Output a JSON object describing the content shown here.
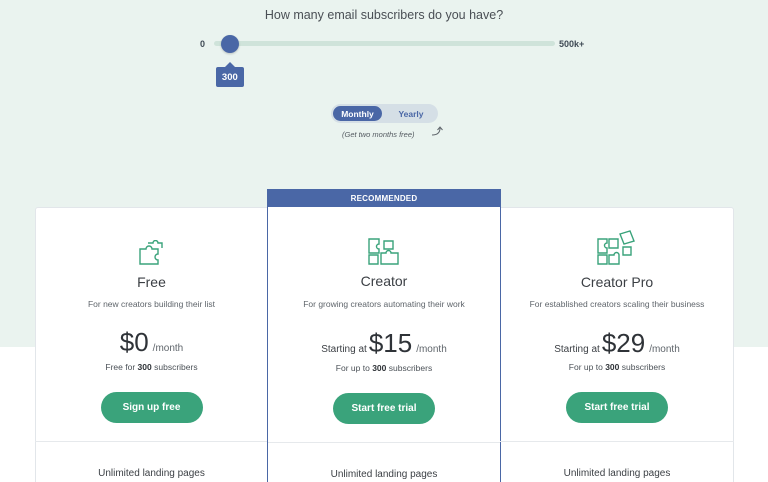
{
  "question": "How many email subscribers do you have?",
  "slider": {
    "min_label": "0",
    "max_label": "500k+",
    "value_label": "300",
    "value_fraction": 0.03
  },
  "billing_toggle": {
    "monthly": "Monthly",
    "yearly": "Yearly",
    "selected": "Monthly",
    "promo": "(Get two months free)"
  },
  "colors": {
    "brand_blue": "#4a67a6",
    "cta_green": "#3aa37b",
    "mint_bg": "#eaf3ef"
  },
  "plans": [
    {
      "name": "Free",
      "icon": "puzzle-piece-icon",
      "description": "For new creators building their list",
      "starting_prefix": "",
      "price": "$0",
      "period": "/month",
      "subs_prefix": "Free for",
      "subs_count": "300",
      "subs_suffix": "subscribers",
      "cta": "Sign up free",
      "feature": "Unlimited landing pages"
    },
    {
      "name": "Creator",
      "icon": "puzzle-pieces-icon",
      "badge": "RECOMMENDED",
      "description": "For growing creators automating their work",
      "starting_prefix": "Starting at",
      "price": "$15",
      "period": "/month",
      "subs_prefix": "For up to",
      "subs_count": "300",
      "subs_suffix": "subscribers",
      "cta": "Start free trial",
      "feature": "Unlimited landing pages"
    },
    {
      "name": "Creator Pro",
      "icon": "puzzle-full-icon",
      "description": "For established creators scaling their business",
      "starting_prefix": "Starting at",
      "price": "$29",
      "period": "/month",
      "subs_prefix": "For up to",
      "subs_count": "300",
      "subs_suffix": "subscribers",
      "cta": "Start free trial",
      "feature": "Unlimited landing pages"
    }
  ]
}
